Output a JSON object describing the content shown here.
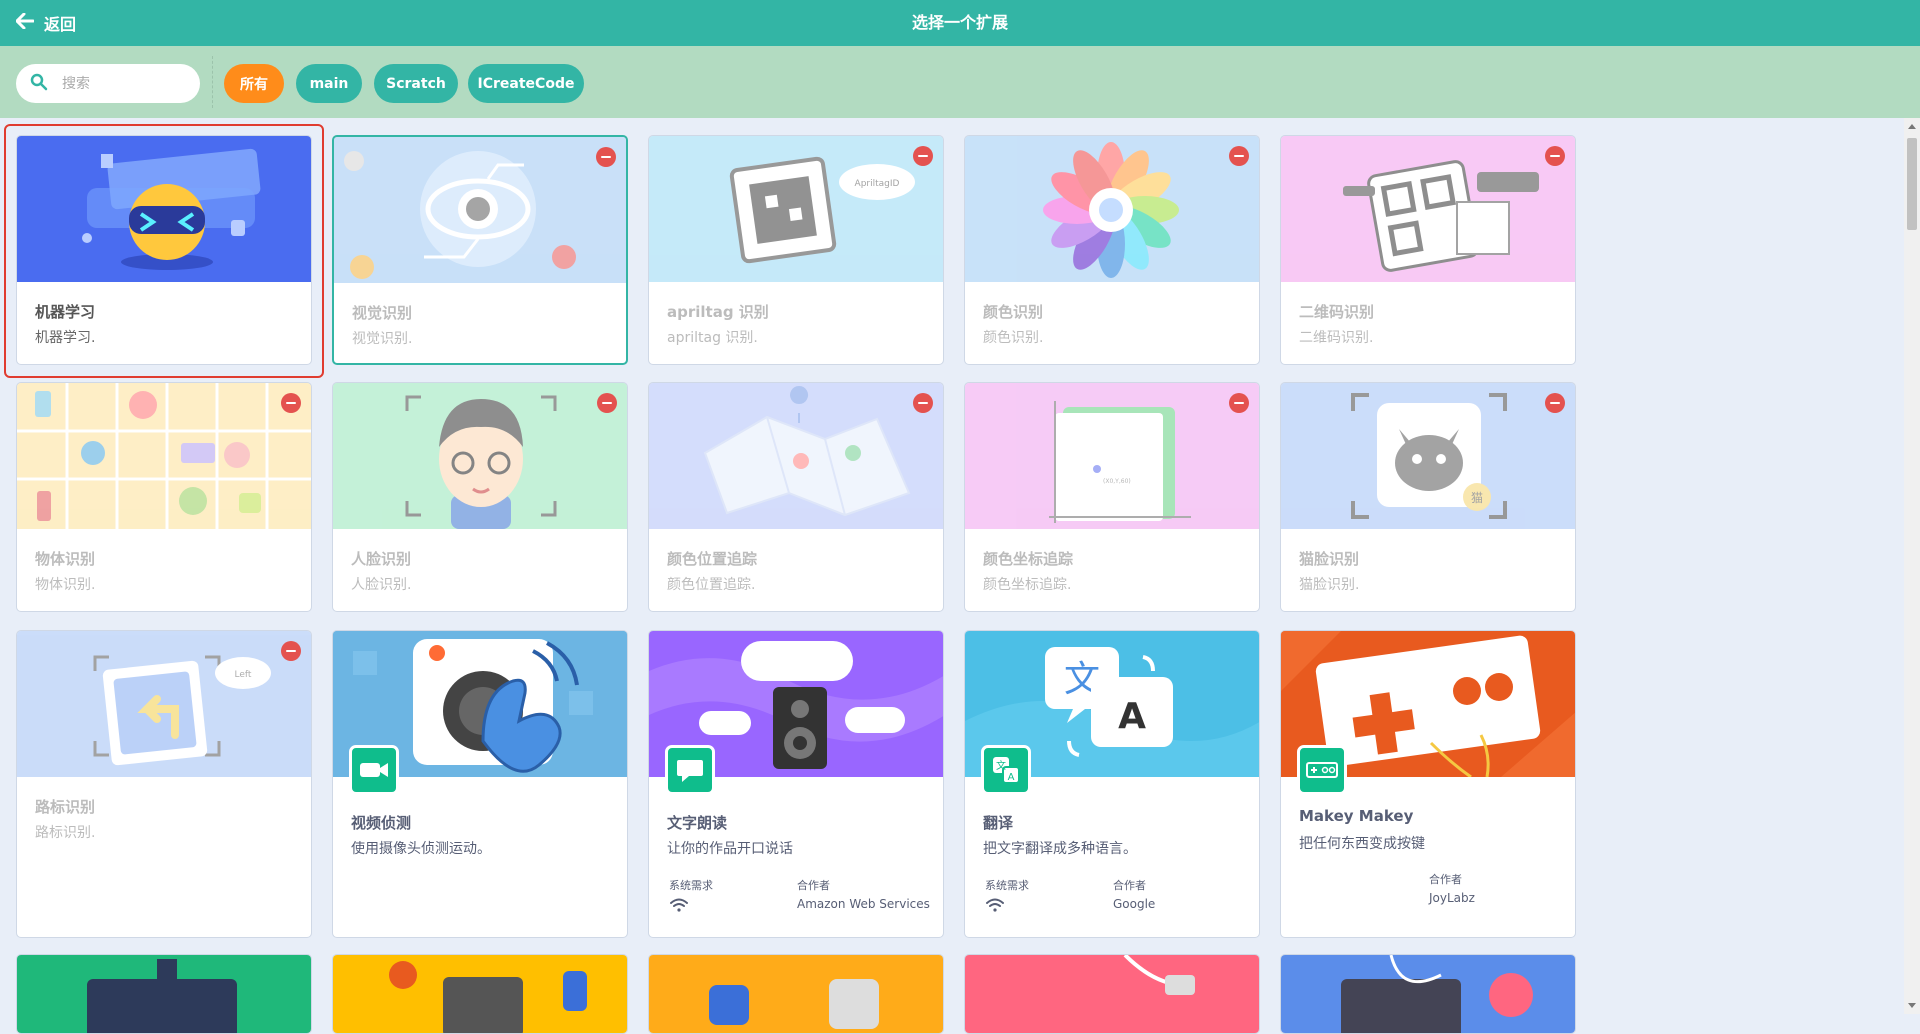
{
  "header": {
    "back_label": "返回",
    "title": "选择一个扩展"
  },
  "search": {
    "placeholder": "搜索"
  },
  "filters": [
    "所有",
    "main",
    "Scratch",
    "ICreateCode"
  ],
  "colors": {
    "header": "#33b5a5",
    "filter_bar": "#b2dbc1",
    "chip": "#33b5a5",
    "chip_active": "#ff8c1a",
    "remove": "#e4524f",
    "selection": "#e03c30"
  },
  "cards": [
    {
      "title": "机器学习",
      "desc": "机器学习.",
      "state": "normal",
      "icon": "robot-ml-banner"
    },
    {
      "title": "视觉识别",
      "desc": "视觉识别.",
      "state": "dim",
      "icon": "eye-banner"
    },
    {
      "title": "apriltag 识别",
      "desc": "apriltag 识别.",
      "state": "dim",
      "icon": "apriltag-banner"
    },
    {
      "title": "颜色识别",
      "desc": "颜色识别.",
      "state": "dim",
      "icon": "color-wheel-banner"
    },
    {
      "title": "二维码识别",
      "desc": "二维码识别.",
      "state": "dim",
      "icon": "qr-code-banner"
    },
    {
      "title": "物体识别",
      "desc": "物体识别.",
      "state": "dim",
      "icon": "objects-banner"
    },
    {
      "title": "人脸识别",
      "desc": "人脸识别.",
      "state": "dim",
      "icon": "face-banner"
    },
    {
      "title": "颜色位置追踪",
      "desc": "颜色位置追踪.",
      "state": "dim",
      "icon": "map-banner"
    },
    {
      "title": "颜色坐标追踪",
      "desc": "颜色坐标追踪.",
      "state": "dim",
      "icon": "coordinate-banner"
    },
    {
      "title": "猫脸识别",
      "desc": "猫脸识别.",
      "state": "dim",
      "icon": "cat-face-banner"
    },
    {
      "title": "路标识别",
      "desc": "路标识别.",
      "state": "dim",
      "icon": "road-sign-banner"
    },
    {
      "title": "视频侦测",
      "desc": "使用摄像头侦测运动。",
      "state": "normal",
      "icon": "video-sensing-banner"
    },
    {
      "title": "文字朗读",
      "desc": "让你的作品开口说话",
      "state": "normal",
      "icon": "text-to-speech-banner",
      "requirement_label": "系统需求",
      "partner_label": "合作者",
      "partner": "Amazon Web Services"
    },
    {
      "title": "翻译",
      "desc": "把文字翻译成多种语言。",
      "state": "normal",
      "icon": "translate-banner",
      "requirement_label": "系统需求",
      "partner_label": "合作者",
      "partner": "Google"
    },
    {
      "title": "Makey Makey",
      "desc": "把任何东西变成按键",
      "state": "normal",
      "icon": "makey-makey-banner",
      "partner_label": "合作者",
      "partner": "JoyLabz"
    }
  ],
  "extra_labels": {
    "apriltag_bubble": "ApriltagID",
    "road_sign_bubble": "Left",
    "cat_badge": "猫",
    "coord_label": "(X0,Y,60)"
  }
}
